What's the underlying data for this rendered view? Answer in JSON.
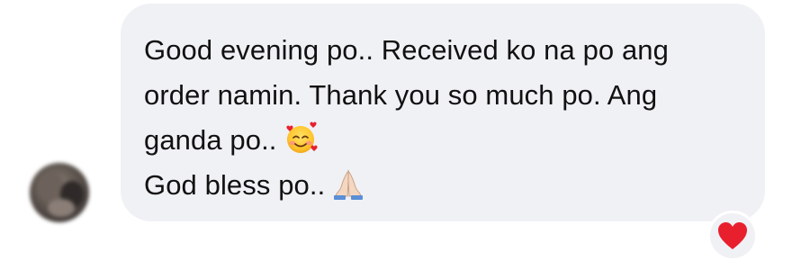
{
  "sender": {
    "avatar_label": "sender-avatar"
  },
  "message": {
    "lines": [
      "Good evening po.. Received ko na po ang",
      "order namin. Thank you so much po. Ang",
      "ganda po..",
      "God bless po.."
    ],
    "emoji_line3": "smiling-face-with-hearts",
    "emoji_line4": "folded-hands"
  },
  "reaction": {
    "icon": "red-heart-icon",
    "color": "#e8202e"
  },
  "colors": {
    "bubble": "#f0f1f5",
    "text": "#111111",
    "background": "#ffffff"
  }
}
